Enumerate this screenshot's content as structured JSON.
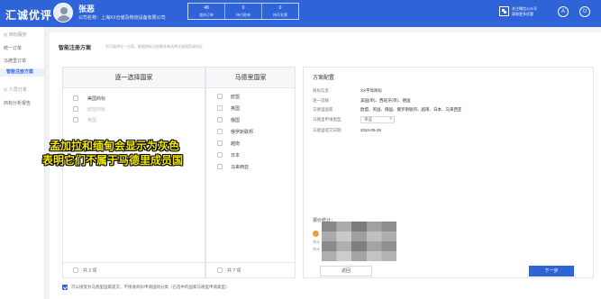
{
  "header": {
    "logo": "汇诚优评",
    "user_name": "张恶",
    "company": "公司名称：上海XX仓储及物流设备有限公司",
    "stats": [
      {
        "value": "48",
        "label": "我的订单"
      },
      {
        "value": "0",
        "label": "待付款单"
      },
      {
        "value": "0",
        "label": "待开发票"
      }
    ],
    "qr_text_1": "关注微信公众号",
    "qr_text_2": "获取更多优惠",
    "icon_a": "A",
    "icon_power": "⏻"
  },
  "sidebar": {
    "items": [
      {
        "label": "◎ 商标服务",
        "type": "group"
      },
      {
        "label": "统一订单",
        "type": "item"
      },
      {
        "label": "马德里订单",
        "type": "item"
      },
      {
        "label": "智能注册方案",
        "type": "active"
      },
      {
        "label": "◎ 人员订单",
        "type": "group"
      },
      {
        "label": "商标分析报告",
        "type": "item"
      }
    ]
  },
  "main": {
    "title": "智能注册方案",
    "hint": "您可选择任一方案，根据商标注册需求来选择注册国家或地区",
    "left_panel": {
      "title": "逐一选择国家",
      "options": [
        {
          "label": "美国商标",
          "checked": false,
          "disabled": false
        },
        {
          "label": "欧盟商标",
          "checked": false,
          "disabled": true
        },
        {
          "label": "英国",
          "checked": false,
          "disabled": true
        }
      ],
      "footer_label": "共 2 项"
    },
    "middle_panel": {
      "title": "马德里国家",
      "options": [
        {
          "label": "欧盟",
          "checked": false
        },
        {
          "label": "英国",
          "checked": false
        },
        {
          "label": "俄国",
          "checked": false
        },
        {
          "label": "俄罗斯联邦",
          "checked": false
        },
        {
          "label": "越南",
          "checked": false
        },
        {
          "label": "日本",
          "checked": false
        },
        {
          "label": "马来西亚",
          "checked": false
        }
      ],
      "footer_label": "共 7 项"
    },
    "summary": {
      "title": "方案配置",
      "rows": [
        {
          "label": "商标信息",
          "value": "XX字母商标"
        },
        {
          "label": "逐一选择",
          "value": "美国(单)、西班牙(单)、德国"
        },
        {
          "label": "马德里国家",
          "value": "欧盟、英国、俄国、俄罗斯联邦、越南、日本、马来西亚"
        }
      ],
      "select_label": "马德里申请类型",
      "select_value": "单证",
      "date_label": "马德里提交日期",
      "date_value": "2024-05-26",
      "pay_label": "报价统计：",
      "small_1": "合计",
      "small_2": "共计",
      "back_label": "返回",
      "next_label": "下一步"
    },
    "agree_text": "可以接受为马德里国家提交，不接收商标申请国际分类（已选中的国家马德里申请类型）"
  },
  "overlay": {
    "line1": "孟加拉和缅甸会显示为灰色",
    "line2": "表明它们不属于马德里成员国"
  }
}
